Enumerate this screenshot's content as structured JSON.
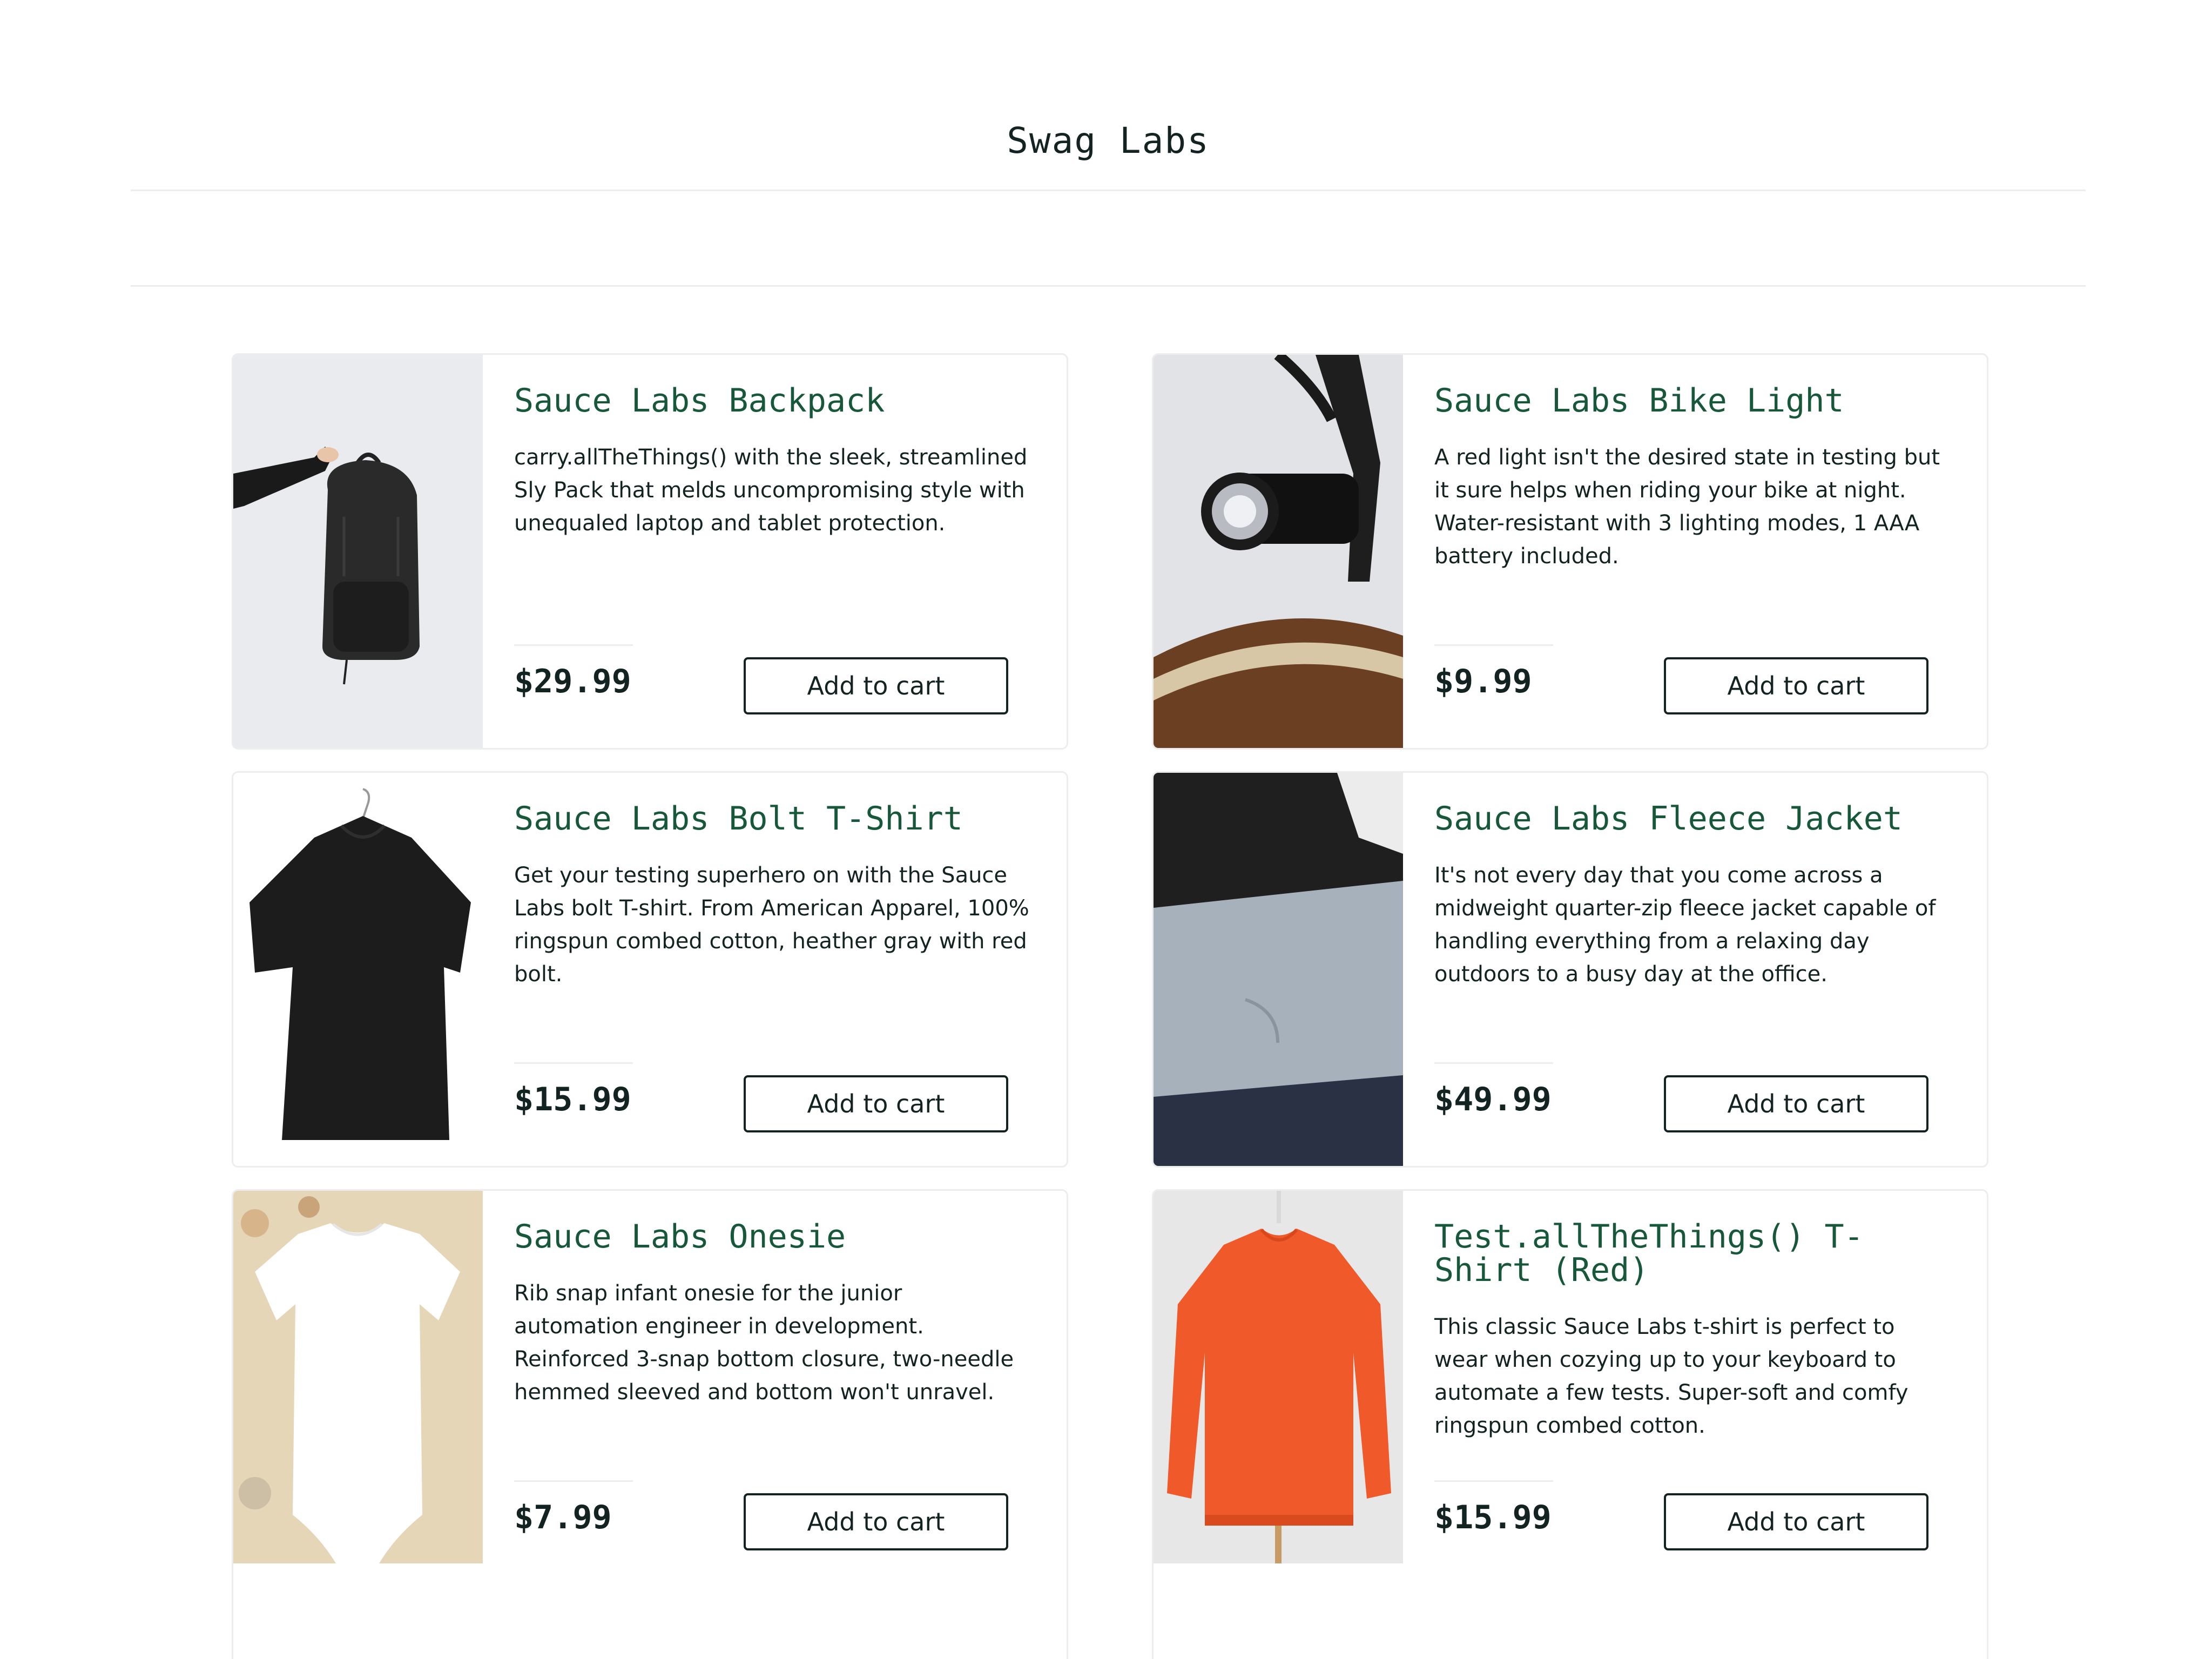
{
  "header": {
    "title": "Swag Labs"
  },
  "products": [
    {
      "name": "Sauce Labs Backpack",
      "description": "carry.allTheThings() with the sleek, streamlined Sly Pack that melds uncompromising style with unequaled laptop and tablet protection.",
      "price": "$29.99",
      "button_label": "Add to cart",
      "image_icon": "backpack-image"
    },
    {
      "name": "Sauce Labs Bike Light",
      "description": "A red light isn't the desired state in testing but it sure helps when riding your bike at night. Water-resistant with 3 lighting modes, 1 AAA battery included.",
      "price": "$9.99",
      "button_label": "Add to cart",
      "image_icon": "bike-light-image"
    },
    {
      "name": "Sauce Labs Bolt T-Shirt",
      "description": "Get your testing superhero on with the Sauce Labs bolt T-shirt. From American Apparel, 100% ringspun combed cotton, heather gray with red bolt.",
      "price": "$15.99",
      "button_label": "Add to cart",
      "image_icon": "tshirt-image"
    },
    {
      "name": "Sauce Labs Fleece Jacket",
      "description": "It's not every day that you come across a midweight quarter-zip fleece jacket capable of handling everything from a relaxing day outdoors to a busy day at the office.",
      "price": "$49.99",
      "button_label": "Add to cart",
      "image_icon": "fleece-jacket-image"
    },
    {
      "name": "Sauce Labs Onesie",
      "description": "Rib snap infant onesie for the junior automation engineer in development. Reinforced 3-snap bottom closure, two-needle hemmed sleeved and bottom won't unravel.",
      "price": "$7.99",
      "button_label": "Add to cart",
      "image_icon": "onesie-image"
    },
    {
      "name": "Test.allTheThings() T-Shirt (Red)",
      "description": "This classic Sauce Labs t-shirt is perfect to wear when cozying up to your keyboard to automate a few tests. Super-soft and comfy ringspun combed cotton.",
      "price": "$15.99",
      "button_label": "Add to cart",
      "image_icon": "red-sweatshirt-image"
    }
  ],
  "colors": {
    "accent_green": "#18583a",
    "text": "#132322",
    "border": "#ededed"
  }
}
